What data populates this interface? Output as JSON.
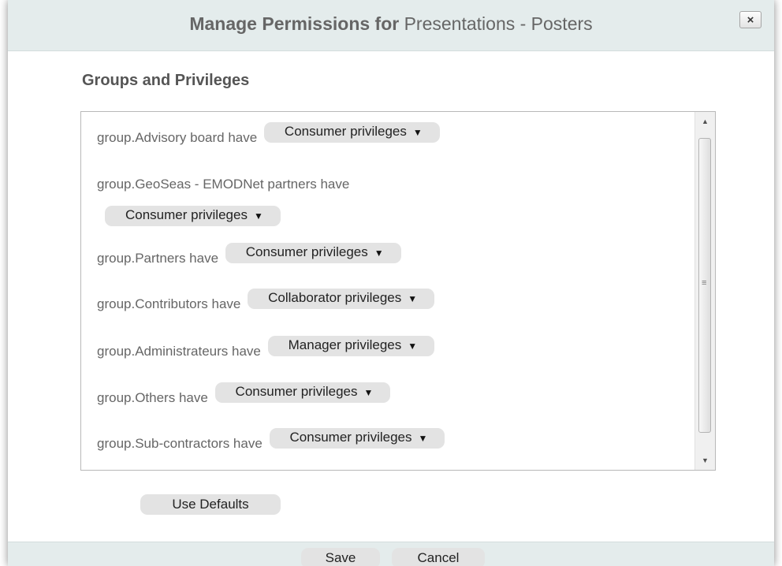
{
  "dialog": {
    "title_bold": "Manage Permissions for",
    "title_target": "Presentations - Posters",
    "close_label": "×"
  },
  "section": {
    "title": "Groups and Privileges"
  },
  "permissions": [
    {
      "group": "group.Advisory board have",
      "privilege": "Consumer privileges"
    },
    {
      "group": "group.GeoSeas - EMODNet partners have",
      "privilege": "Consumer privileges"
    },
    {
      "group": "group.Partners have",
      "privilege": "Consumer privileges"
    },
    {
      "group": "group.Contributors have",
      "privilege": "Collaborator privileges"
    },
    {
      "group": "group.Administrateurs have",
      "privilege": "Manager privileges"
    },
    {
      "group": "group.Others have",
      "privilege": "Consumer privileges"
    },
    {
      "group": "group.Sub-contractors have",
      "privilege": "Consumer privileges"
    }
  ],
  "buttons": {
    "use_defaults": "Use Defaults",
    "save": "Save",
    "cancel": "Cancel"
  },
  "icons": {
    "dropdown": "caret-down-icon",
    "close": "close-icon",
    "scroll_up": "scroll-up-arrow-icon",
    "scroll_down": "scroll-down-arrow-icon"
  },
  "colors": {
    "header_bg": "#e4ecec",
    "button_bg": "#e3e3e3",
    "label_text": "#666666"
  }
}
